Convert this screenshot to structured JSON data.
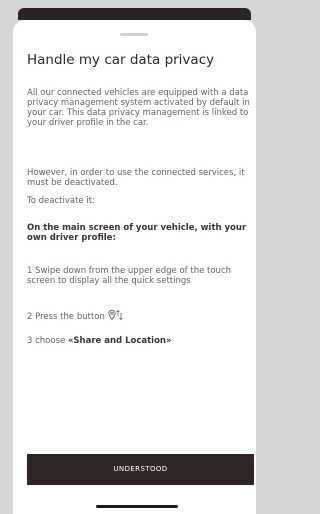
{
  "sheet": {
    "title": "Handle my car data privacy",
    "paragraph_1": "All our connected vehicles are equipped with a data privacy management system activated by default in your car. This data privacy management is linked to your driver profile in the car.",
    "paragraph_2": "However, in order to use the connected services, it must be deactivated.",
    "paragraph_3": "To deactivate it:",
    "paragraph_4": "On the main screen of your vehicle, with your own driver profile:",
    "step_1": "1 Swipe down from the upper edge of the touch screen to display all the quick settings",
    "step_2": "2 Press the button",
    "step_3_prefix": "3 choose ",
    "step_3_bold": "«Share and Location»",
    "button_label": "UNDERSTOOD"
  },
  "colors": {
    "backdrop": "#d6d6d6",
    "button_bg": "#2e2725",
    "title_text": "#2d2826",
    "body_text": "#6a6361"
  },
  "icons": {
    "step_2_icon": "location-pin-arrows-icon"
  }
}
